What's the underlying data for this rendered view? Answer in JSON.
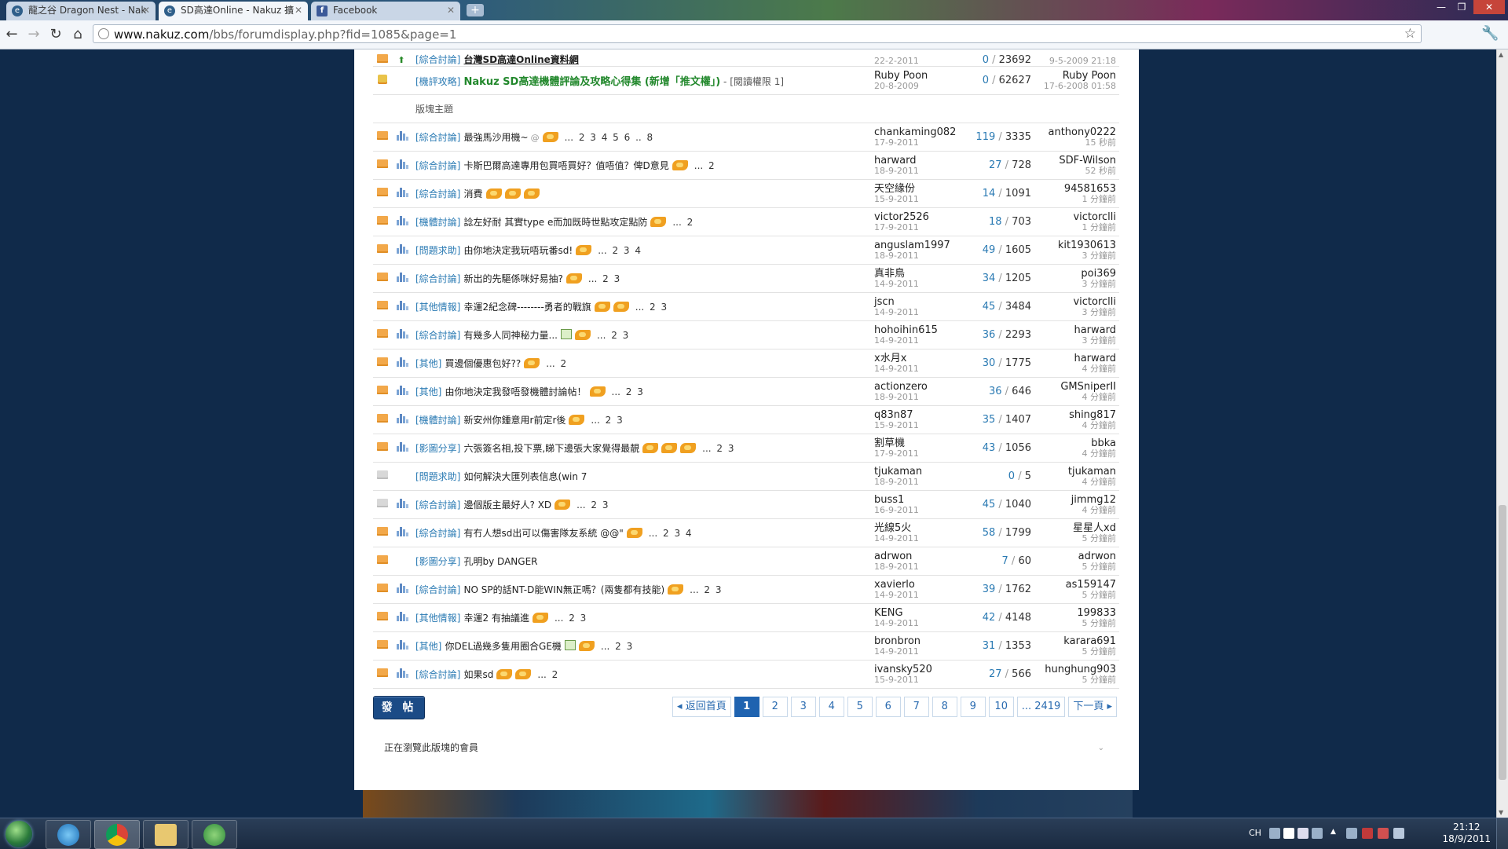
{
  "browser": {
    "tabs": [
      {
        "title": "龍之谷 Dragon Nest - Nak",
        "icon": "ie-icon"
      },
      {
        "title": "SD高達Online - Nakuz 擴",
        "icon": "chrome-page-icon",
        "active": true
      },
      {
        "title": "Facebook",
        "icon": "facebook-icon"
      }
    ],
    "url_host": "www.nakuz.com",
    "url_path": "/bbs/forumdisplay.php?fid=1085&page=1"
  },
  "forum": {
    "top_rows": [
      {
        "category": "[綜合討論]",
        "title": "台灣SD高達Online資料網",
        "style": "underline",
        "author": "",
        "date": "22-2-2011",
        "replies": "0",
        "views": "23692",
        "last_user": "",
        "last_time": "9-5-2009 21:18",
        "icon": "gold-folder-icon"
      },
      {
        "category": "[機評攻略]",
        "title": "Nakuz SD高達機體評論及攻略心得集 (新增「推文權」)",
        "suffix": " - [閱讀權限 1]",
        "style": "green",
        "author": "Ruby Poon",
        "date": "20-8-2009",
        "replies": "0",
        "views": "62627",
        "last_user": "Ruby Poon",
        "last_time": "17-6-2008 01:58",
        "icon": "lock-icon"
      }
    ],
    "section_label": "版塊主題",
    "threads": [
      {
        "category": "[綜合討論]",
        "title": "最強馬沙用機~",
        "decor": [
          "clip",
          "hot"
        ],
        "pages": "... 2 3 4 5 6 .. 8",
        "author": "chankaming082",
        "date": "17-9-2011",
        "replies": "119",
        "views": "3335",
        "last_user": "anthony0222",
        "last_time": "15 秒前",
        "folder": "orange"
      },
      {
        "category": "[綜合討論]",
        "title": "卡斯巴爾高達專用包買唔買好？值唔值？俾D意見",
        "decor": [
          "hot"
        ],
        "pages": "... 2",
        "author": "harward",
        "date": "18-9-2011",
        "replies": "27",
        "views": "728",
        "last_user": "SDF-Wilson",
        "last_time": "52 秒前",
        "folder": "orange"
      },
      {
        "category": "[綜合討論]",
        "title": "消費",
        "decor": [
          "hot",
          "hot",
          "hot"
        ],
        "pages": "",
        "author": "天空緣份",
        "date": "15-9-2011",
        "replies": "14",
        "views": "1091",
        "last_user": "94581653",
        "last_time": "1 分鐘前",
        "folder": "orange"
      },
      {
        "category": "[機體討論]",
        "title": "諗左好耐 其實type e而加既時世點攻定點防",
        "decor": [
          "hot"
        ],
        "pages": "... 2",
        "author": "victor2526",
        "date": "17-9-2011",
        "replies": "18",
        "views": "703",
        "last_user": "victorclli",
        "last_time": "1 分鐘前",
        "folder": "orange"
      },
      {
        "category": "[問題求助]",
        "title": "由你地決定我玩唔玩番sd!",
        "decor": [
          "hot"
        ],
        "pages": "... 2 3 4",
        "author": "anguslam1997",
        "date": "18-9-2011",
        "replies": "49",
        "views": "1605",
        "last_user": "kit1930613",
        "last_time": "3 分鐘前",
        "folder": "orange"
      },
      {
        "category": "[綜合討論]",
        "title": "新出的先驅係咪好易抽?",
        "decor": [
          "hot"
        ],
        "pages": "... 2 3",
        "author": "真非鳥",
        "date": "14-9-2011",
        "replies": "34",
        "views": "1205",
        "last_user": "poi369",
        "last_time": "3 分鐘前",
        "folder": "orange"
      },
      {
        "category": "[其他情報]",
        "title": "幸運2紀念碑--------勇者的戰旗",
        "decor": [
          "hot",
          "hot"
        ],
        "pages": "... 2 3",
        "author": "jscn",
        "date": "14-9-2011",
        "replies": "45",
        "views": "3484",
        "last_user": "victorclli",
        "last_time": "3 分鐘前",
        "folder": "orange"
      },
      {
        "category": "[綜合討論]",
        "title": "有幾多人同神秘力量...",
        "decor": [
          "img",
          "hot"
        ],
        "pages": "... 2 3",
        "author": "hohoihin615",
        "date": "14-9-2011",
        "replies": "36",
        "views": "2293",
        "last_user": "harward",
        "last_time": "3 分鐘前",
        "folder": "orange"
      },
      {
        "category": "[其他]",
        "title": "買邊個優惠包好??",
        "decor": [
          "hot"
        ],
        "pages": "... 2",
        "author": "x水月x",
        "date": "14-9-2011",
        "replies": "30",
        "views": "1775",
        "last_user": "harward",
        "last_time": "4 分鐘前",
        "folder": "orange"
      },
      {
        "category": "[其他]",
        "title": "由你地決定我發唔發機體討論帖！",
        "decor": [
          "hot"
        ],
        "pages": "... 2 3",
        "author": "actionzero",
        "date": "18-9-2011",
        "replies": "36",
        "views": "646",
        "last_user": "GMSniperII",
        "last_time": "4 分鐘前",
        "folder": "orange"
      },
      {
        "category": "[機體討論]",
        "title": "新安州你鍾意用r前定r後",
        "decor": [
          "hot"
        ],
        "pages": "... 2 3",
        "author": "q83n87",
        "date": "15-9-2011",
        "replies": "35",
        "views": "1407",
        "last_user": "shing817",
        "last_time": "4 分鐘前",
        "folder": "orange"
      },
      {
        "category": "[影圖分享]",
        "title": "六張簽名相,投下票,睇下邊張大家覺得最靚",
        "decor": [
          "hot",
          "hot",
          "hot"
        ],
        "pages": "... 2 3",
        "author": "割草機",
        "date": "17-9-2011",
        "replies": "43",
        "views": "1056",
        "last_user": "bbka",
        "last_time": "4 分鐘前",
        "folder": "orange"
      },
      {
        "category": "[問題求助]",
        "title": "如何解決大匯列表信息(win 7",
        "decor": [],
        "pages": "",
        "author": "tjukaman",
        "date": "18-9-2011",
        "replies": "0",
        "views": "5",
        "last_user": "tjukaman",
        "last_time": "4 分鐘前",
        "folder": "grey",
        "nochart": true
      },
      {
        "category": "[綜合討論]",
        "title": "邊個版主最好人? XD",
        "decor": [
          "hot"
        ],
        "pages": "... 2 3",
        "author": "buss1",
        "date": "16-9-2011",
        "replies": "45",
        "views": "1040",
        "last_user": "jimmg12",
        "last_time": "4 分鐘前",
        "folder": "grey"
      },
      {
        "category": "[綜合討論]",
        "title": "有冇人想sd出可以傷害隊友系統                    @@\"",
        "decor": [
          "hot"
        ],
        "pages": "... 2 3 4",
        "author": "光線5火",
        "date": "14-9-2011",
        "replies": "58",
        "views": "1799",
        "last_user": "星星人xd",
        "last_time": "5 分鐘前",
        "folder": "orange"
      },
      {
        "category": "[影圖分享]",
        "title": "孔明by DANGER",
        "decor": [],
        "pages": "",
        "author": "adrwon",
        "date": "18-9-2011",
        "replies": "7",
        "views": "60",
        "last_user": "adrwon",
        "last_time": "5 分鐘前",
        "folder": "orange",
        "nochart": true
      },
      {
        "category": "[綜合討論]",
        "title": "NO SP的話NT-D能WIN無正嗎？(兩隻都有技能)",
        "decor": [
          "hot"
        ],
        "pages": "... 2 3",
        "author": "xavierlo",
        "date": "14-9-2011",
        "replies": "39",
        "views": "1762",
        "last_user": "as159147",
        "last_time": "5 分鐘前",
        "folder": "orange"
      },
      {
        "category": "[其他情報]",
        "title": "幸運2 有抽議進",
        "decor": [
          "hot"
        ],
        "pages": "... 2 3",
        "author": "KENG",
        "date": "14-9-2011",
        "replies": "42",
        "views": "4148",
        "last_user": "199833",
        "last_time": "5 分鐘前",
        "folder": "orange"
      },
      {
        "category": "[其他]",
        "title": "你DEL過幾多隻用圈合GE機",
        "decor": [
          "img",
          "hot"
        ],
        "pages": "... 2 3",
        "author": "bronbron",
        "date": "14-9-2011",
        "replies": "31",
        "views": "1353",
        "last_user": "karara691",
        "last_time": "5 分鐘前",
        "folder": "orange"
      },
      {
        "category": "[綜合討論]",
        "title": "如果sd",
        "decor": [
          "hot",
          "hot"
        ],
        "pages": "... 2",
        "author": "ivansky520",
        "date": "15-9-2011",
        "replies": "27",
        "views": "566",
        "last_user": "hunghung903",
        "last_time": "5 分鐘前",
        "folder": "orange"
      }
    ],
    "post_button": "發 帖",
    "pager": {
      "prev": "◂ 返回首頁",
      "pages": [
        "1",
        "2",
        "3",
        "4",
        "5",
        "6",
        "7",
        "8",
        "9",
        "10",
        "... 2419"
      ],
      "current": "1",
      "next": "下一頁 ▸"
    },
    "viewers_label": "正在瀏覽此版塊的會員"
  },
  "taskbar": {
    "lang": "CH",
    "time": "21:12",
    "date": "18/9/2011"
  },
  "colors": {
    "link_blue": "#2a7ab3",
    "green_title": "#22882c",
    "page_bg": "#102a4a",
    "current_page": "#1f63b0"
  }
}
